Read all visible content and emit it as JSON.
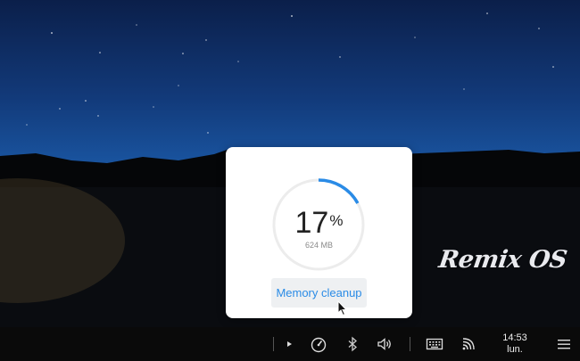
{
  "wallpaper": {
    "logo_text": "Remix OS"
  },
  "memory_panel": {
    "percent_value": "17",
    "percent_sign": "%",
    "used_fraction": 0.17,
    "memory_size": "624 MB",
    "cleanup_label": "Memory cleanup",
    "accent_color": "#2a8be6"
  },
  "taskbar": {
    "icons": [
      "play-icon",
      "speedometer-icon",
      "bluetooth-icon",
      "volume-icon",
      "keyboard-icon",
      "cast-icon",
      "menu-icon"
    ],
    "clock_time": "14:53",
    "clock_day": "lun."
  }
}
